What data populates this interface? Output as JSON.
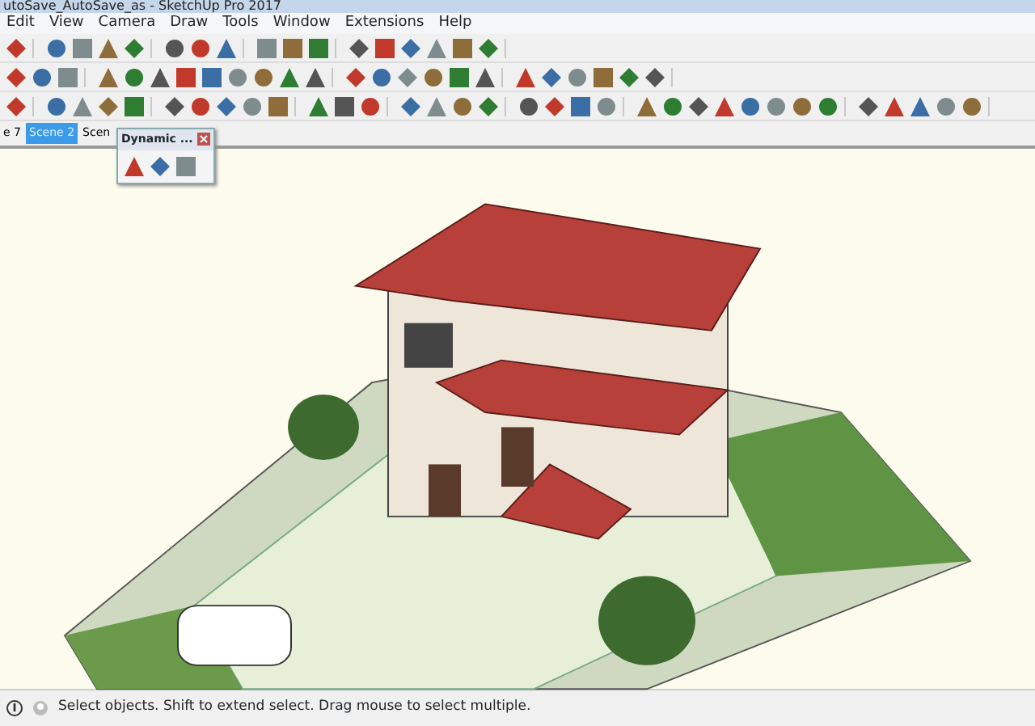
{
  "window": {
    "title": "utoSave_AutoSave_as - SketchUp Pro 2017"
  },
  "menu": [
    "Edit",
    "View",
    "Camera",
    "Draw",
    "Tools",
    "Window",
    "Extensions",
    "Help"
  ],
  "scene_tabs": [
    {
      "label": "e 7",
      "selected": false
    },
    {
      "label": "Scene 2",
      "selected": true
    },
    {
      "label": "Scen",
      "selected": false
    }
  ],
  "floating_panel": {
    "title": "Dynamic ..."
  },
  "status_bar": {
    "message": "Select objects. Shift to extend select. Drag mouse to select multiple."
  }
}
